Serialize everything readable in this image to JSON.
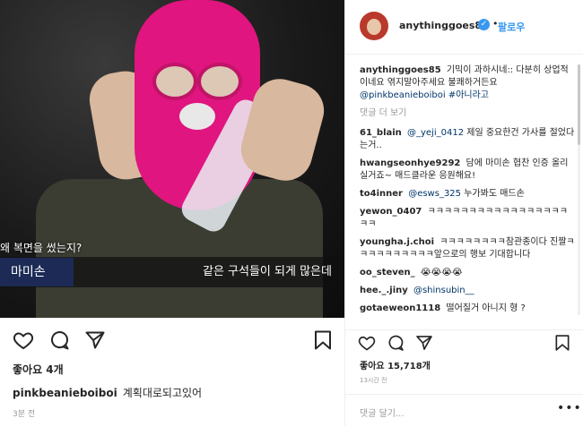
{
  "left": {
    "video": {
      "caption_top": "왜 복면을 썼는지?",
      "caption_name": "마미손",
      "caption_line": "같은 구석들이 되게 많은데"
    },
    "likes": "좋아요 4개",
    "caption": {
      "username": "pinkbeanieboiboi",
      "text": "계획대로되고있어"
    },
    "time": "3분 전",
    "icons": [
      "heart-icon",
      "comment-icon",
      "share-icon",
      "bookmark-icon"
    ]
  },
  "right": {
    "header": {
      "username": "anythinggoes85",
      "dot": "•",
      "follow_label": "팔로우"
    },
    "post_text": {
      "username": "anythinggoes85",
      "text": "기믹이 과하시네:: 다분히 상업적이네요 엮지말아주세요 불쾌하거든요",
      "mention": "@pinkbeanieboiboi",
      "tag": "#아니라고"
    },
    "more_comments": "댓글 더 보기",
    "comments": [
      {
        "user": "61_blain",
        "mention": "@_yeji_0412",
        "text": "제일 중요한건 가사를 절었다는거.."
      },
      {
        "user": "hwangseonhye9292",
        "mention": "",
        "text": "담에 마미손 협찬 인증 올리실거죠~ 매드클라운 응원해요!"
      },
      {
        "user": "to4inner",
        "mention": "@esws_325",
        "text": "누가봐도 매드손"
      },
      {
        "user": "yewon_0407",
        "mention": "",
        "text": "ㅋㅋㅋㅋㅋㅋㅋㅋㅋㅋㅋㅋㅋㅋㅋㅋㅋㅋㅋ"
      },
      {
        "user": "youngha.j.choi",
        "mention": "",
        "text": "ㅋㅋㅋㅋㅋㅋㅋㅋ참관종이다 진짤ㅋㅋㅋㅋㅋㅋㅋㅋㅋㅋ앞으로의 행보 기대합니다"
      },
      {
        "user": "oo_steven_",
        "mention": "",
        "text": "😭😭😭😭"
      },
      {
        "user": "hee._.jiny",
        "mention": "@shinsubin__",
        "text": ""
      },
      {
        "user": "gotaeweon1118",
        "mention": "",
        "text": "떨어질거 아니지 형 ?"
      }
    ],
    "likes": "좋아요 15,718개",
    "time": "13시간 전",
    "add_comment_placeholder": "댓글 달기...",
    "more_dots": "•••"
  }
}
